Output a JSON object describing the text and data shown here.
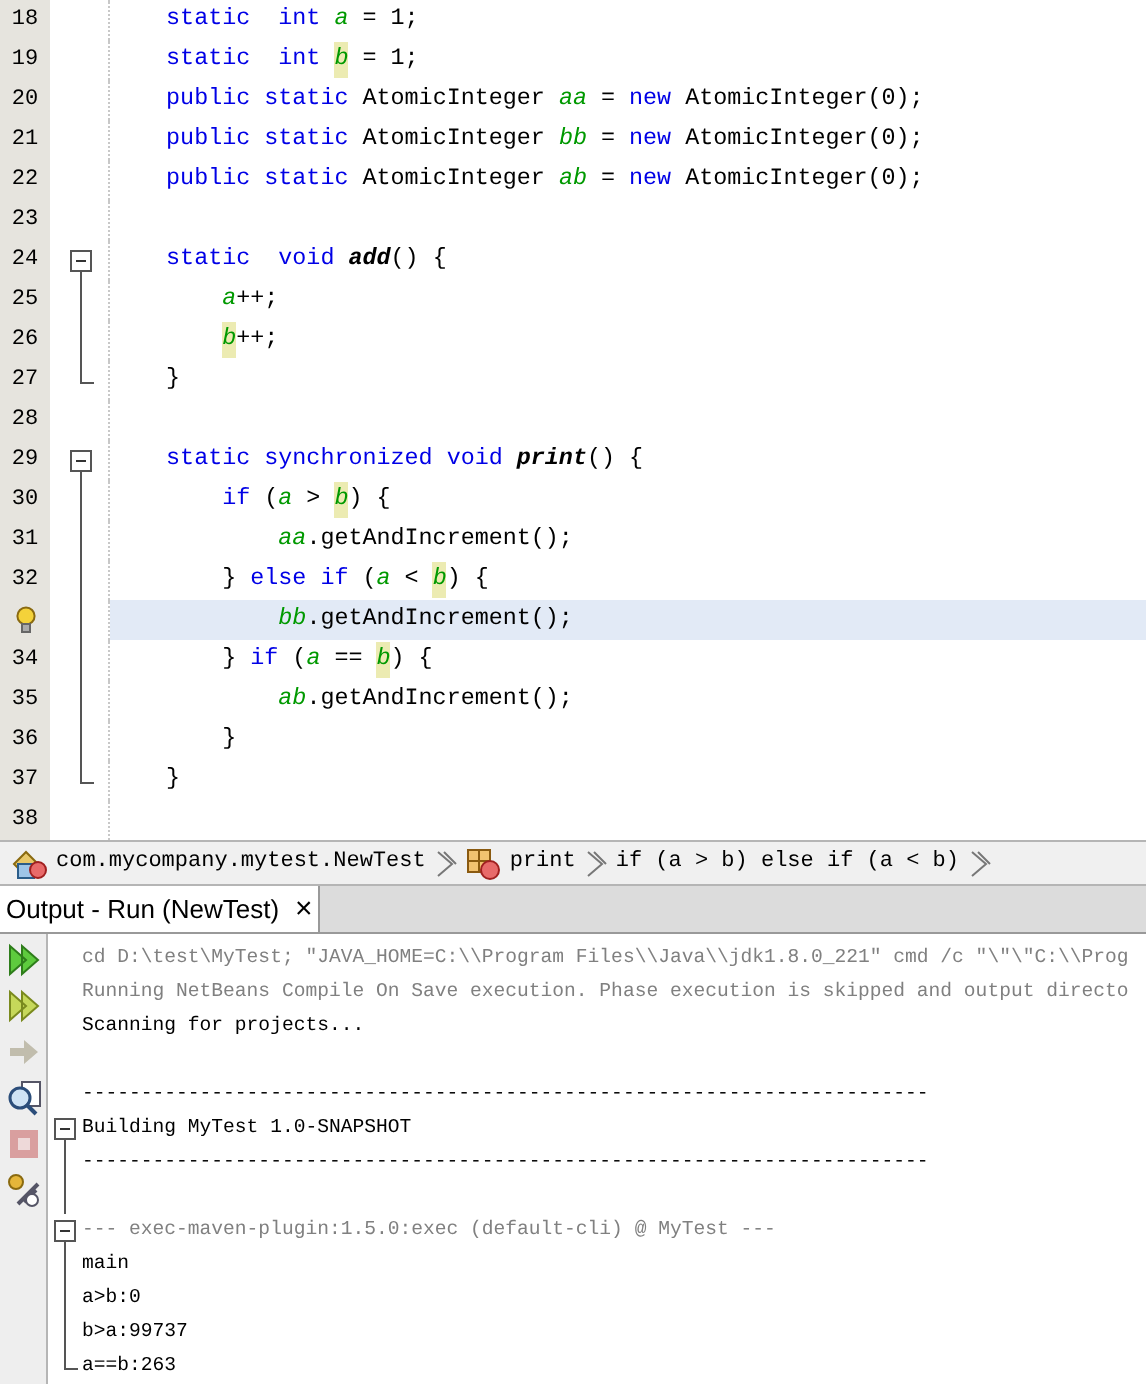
{
  "editor": {
    "lines": [
      {
        "number": "18",
        "kind": "plain",
        "current": false,
        "tokens": [
          {
            "kind": "keyword",
            "text": "static  int "
          },
          {
            "kind": "field",
            "text": "a",
            "marked": false
          },
          {
            "kind": "plain",
            "text": " = 1;"
          }
        ]
      },
      {
        "number": "19",
        "kind": "plain",
        "current": false,
        "tokens": [
          {
            "kind": "keyword",
            "text": "static  int "
          },
          {
            "kind": "field",
            "text": "b",
            "marked": true
          },
          {
            "kind": "plain",
            "text": " = 1;"
          }
        ]
      },
      {
        "number": "20",
        "kind": "plain",
        "current": false,
        "tokens": [
          {
            "kind": "keyword",
            "text": "public static "
          },
          {
            "kind": "plain",
            "text": "AtomicInteger "
          },
          {
            "kind": "field",
            "text": "aa",
            "marked": false
          },
          {
            "kind": "plain",
            "text": " = "
          },
          {
            "kind": "keyword",
            "text": "new "
          },
          {
            "kind": "plain",
            "text": "AtomicInteger(0);"
          }
        ]
      },
      {
        "number": "21",
        "kind": "plain",
        "current": false,
        "tokens": [
          {
            "kind": "keyword",
            "text": "public static "
          },
          {
            "kind": "plain",
            "text": "AtomicInteger "
          },
          {
            "kind": "field",
            "text": "bb",
            "marked": false
          },
          {
            "kind": "plain",
            "text": " = "
          },
          {
            "kind": "keyword",
            "text": "new "
          },
          {
            "kind": "plain",
            "text": "AtomicInteger(0);"
          }
        ]
      },
      {
        "number": "22",
        "kind": "plain",
        "current": false,
        "tokens": [
          {
            "kind": "keyword",
            "text": "public static "
          },
          {
            "kind": "plain",
            "text": "AtomicInteger "
          },
          {
            "kind": "field",
            "text": "ab",
            "marked": false
          },
          {
            "kind": "plain",
            "text": " = "
          },
          {
            "kind": "keyword",
            "text": "new "
          },
          {
            "kind": "plain",
            "text": "AtomicInteger(0);"
          }
        ]
      },
      {
        "number": "23",
        "kind": "plain",
        "current": false
      },
      {
        "number": "24",
        "kind": "fold-start",
        "current": false,
        "tokens": [
          {
            "kind": "keyword",
            "text": "static  void "
          },
          {
            "kind": "method",
            "text": "add"
          },
          {
            "kind": "plain",
            "text": "() {"
          }
        ],
        "children": [
          {
            "number": "25",
            "kind": "fold-inside",
            "current": false,
            "tokens": [
              {
                "kind": "field",
                "text": "a",
                "marked": false
              },
              {
                "kind": "plain",
                "text": "++;"
              }
            ]
          },
          {
            "number": "26",
            "kind": "fold-inside",
            "current": false,
            "tokens": [
              {
                "kind": "field",
                "text": "b",
                "marked": true
              },
              {
                "kind": "plain",
                "text": "++;"
              }
            ]
          }
        ]
      },
      {
        "number": "27",
        "kind": "fold-end",
        "current": false,
        "tokens": [
          {
            "kind": "plain",
            "text": "}"
          }
        ]
      },
      {
        "number": "28",
        "kind": "plain",
        "current": false
      },
      {
        "number": "29",
        "kind": "fold-start",
        "current": false,
        "tokens": [
          {
            "kind": "keyword",
            "text": "static synchronized void "
          },
          {
            "kind": "method",
            "text": "print"
          },
          {
            "kind": "plain",
            "text": "() {"
          }
        ],
        "children": [
          {
            "number": "30",
            "kind": "fold-inside",
            "current": false,
            "tokens": [
              {
                "kind": "keyword",
                "text": "if "
              },
              {
                "kind": "plain",
                "text": "("
              },
              {
                "kind": "field",
                "text": "a",
                "marked": false
              },
              {
                "kind": "plain",
                "text": " > "
              },
              {
                "kind": "field",
                "text": "b",
                "marked": true
              },
              {
                "kind": "plain",
                "text": ") {"
              }
            ],
            "children": [
              {
                "number": "31",
                "kind": "fold-inside",
                "current": false,
                "tokens": [
                  {
                    "kind": "field",
                    "text": "aa",
                    "marked": false
                  },
                  {
                    "kind": "plain",
                    "text": ".getAndIncrement();"
                  }
                ]
              }
            ]
          },
          {
            "number": "32",
            "kind": "fold-inside",
            "current": false,
            "tokens": [
              {
                "kind": "plain",
                "text": "} "
              },
              {
                "kind": "keyword",
                "text": "else if "
              },
              {
                "kind": "plain",
                "text": "("
              },
              {
                "kind": "field",
                "text": "a",
                "marked": false
              },
              {
                "kind": "plain",
                "text": " < "
              },
              {
                "kind": "field",
                "text": "b",
                "marked": true
              },
              {
                "kind": "plain",
                "text": ") {"
              }
            ],
            "children": [
              {
                "has_hint": true,
                "kind": "fold-inside",
                "current": true,
                "tokens": [
                  {
                    "kind": "field",
                    "text": "bb",
                    "marked": false
                  },
                  {
                    "kind": "plain",
                    "text": ".getAndIncrement();"
                  }
                ]
              }
            ]
          },
          {
            "number": "34",
            "kind": "fold-inside",
            "current": false,
            "tokens": [
              {
                "kind": "plain",
                "text": "} "
              },
              {
                "kind": "keyword",
                "text": "if "
              },
              {
                "kind": "plain",
                "text": "("
              },
              {
                "kind": "field",
                "text": "a",
                "marked": false
              },
              {
                "kind": "plain",
                "text": " == "
              },
              {
                "kind": "field",
                "text": "b",
                "marked": true
              },
              {
                "kind": "plain",
                "text": ") {"
              }
            ],
            "children": [
              {
                "number": "35",
                "kind": "fold-inside",
                "current": false,
                "tokens": [
                  {
                    "kind": "field",
                    "text": "ab",
                    "marked": false
                  },
                  {
                    "kind": "plain",
                    "text": ".getAndIncrement();"
                  }
                ]
              }
            ]
          },
          {
            "number": "36",
            "kind": "fold-inside",
            "current": false,
            "tokens": [
              {
                "kind": "plain",
                "text": "}"
              }
            ]
          }
        ]
      },
      {
        "number": "37",
        "kind": "fold-end",
        "current": false,
        "tokens": [
          {
            "kind": "plain",
            "text": "}"
          }
        ]
      },
      {
        "number": "38",
        "kind": "plain",
        "current": false
      }
    ]
  },
  "breadcrumb": [
    {
      "kind": "class",
      "label": "com.mycompany.mytest.NewTest"
    },
    {
      "kind": "method",
      "label": "print"
    },
    {
      "kind": "statement",
      "label": "if (a > b) else if (a < b)"
    }
  ],
  "output": {
    "tab": {
      "label": "Output - Run (NewTest)",
      "close": "×",
      "selected": true
    },
    "toolbar": [
      {
        "kind": "rerun",
        "disabled": false
      },
      {
        "kind": "rerun-options",
        "disabled": false
      },
      {
        "kind": "next",
        "disabled": true
      },
      {
        "kind": "find",
        "disabled": false
      },
      {
        "kind": "stop",
        "disabled": true
      },
      {
        "kind": "settings",
        "disabled": false
      }
    ],
    "lines": [
      {
        "kind": "info",
        "text": "cd D:\\test\\MyTest; \"JAVA_HOME=C:\\\\Program Files\\\\Java\\\\jdk1.8.0_221\" cmd /c \"\\\"\\\"C:\\\\Prog"
      },
      {
        "kind": "info",
        "text": "Running NetBeans Compile On Save execution. Phase execution is skipped and output directo"
      },
      {
        "kind": "plain",
        "text": "Scanning for projects..."
      },
      {
        "kind": "blank"
      },
      {
        "kind": "plain",
        "text": "------------------------------------------------------------------------"
      },
      {
        "kind": "plain",
        "text": "Building MyTest 1.0-SNAPSHOT",
        "children": [
          {
            "kind": "plain",
            "text": "------------------------------------------------------------------------"
          },
          {
            "kind": "blank"
          },
          {
            "kind": "info",
            "text": "--- exec-maven-plugin:1.5.0:exec (default-cli) @ MyTest ---",
            "children": [
              {
                "kind": "plain",
                "text": "main"
              },
              {
                "kind": "plain",
                "text": "a>b:0"
              },
              {
                "kind": "plain",
                "text": "b>a:99737"
              },
              {
                "kind": "plain",
                "text": "a==b:263"
              }
            ]
          }
        ]
      }
    ]
  }
}
